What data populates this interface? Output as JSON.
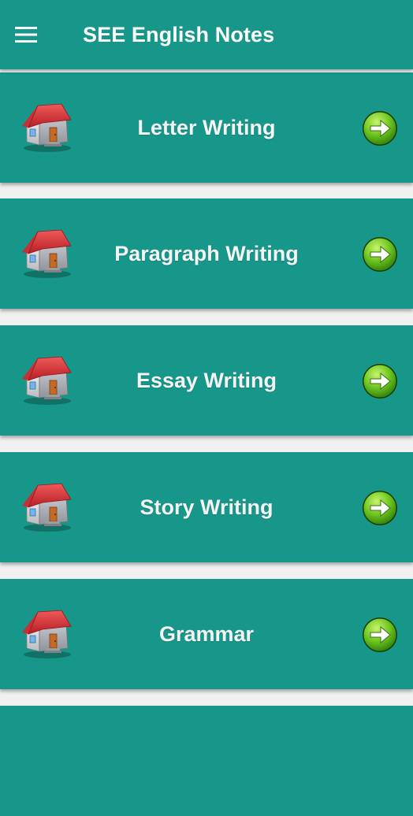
{
  "app_bar": {
    "menu_icon": "hamburger-menu-icon",
    "title": "SEE English Notes"
  },
  "items": [
    {
      "label": "Letter Writing",
      "icon": "house-icon",
      "action_icon": "arrow-right-circle-icon"
    },
    {
      "label": "Paragraph Writing",
      "icon": "house-icon",
      "action_icon": "arrow-right-circle-icon"
    },
    {
      "label": "Essay Writing",
      "icon": "house-icon",
      "action_icon": "arrow-right-circle-icon"
    },
    {
      "label": "Story Writing",
      "icon": "house-icon",
      "action_icon": "arrow-right-circle-icon"
    },
    {
      "label": "Grammar",
      "icon": "house-icon",
      "action_icon": "arrow-right-circle-icon"
    }
  ],
  "colors": {
    "primary": "#17978a",
    "background": "#f1f1f1",
    "text": "#ffffff",
    "roof": "#d9363a",
    "go_button": "#6cc51f"
  }
}
